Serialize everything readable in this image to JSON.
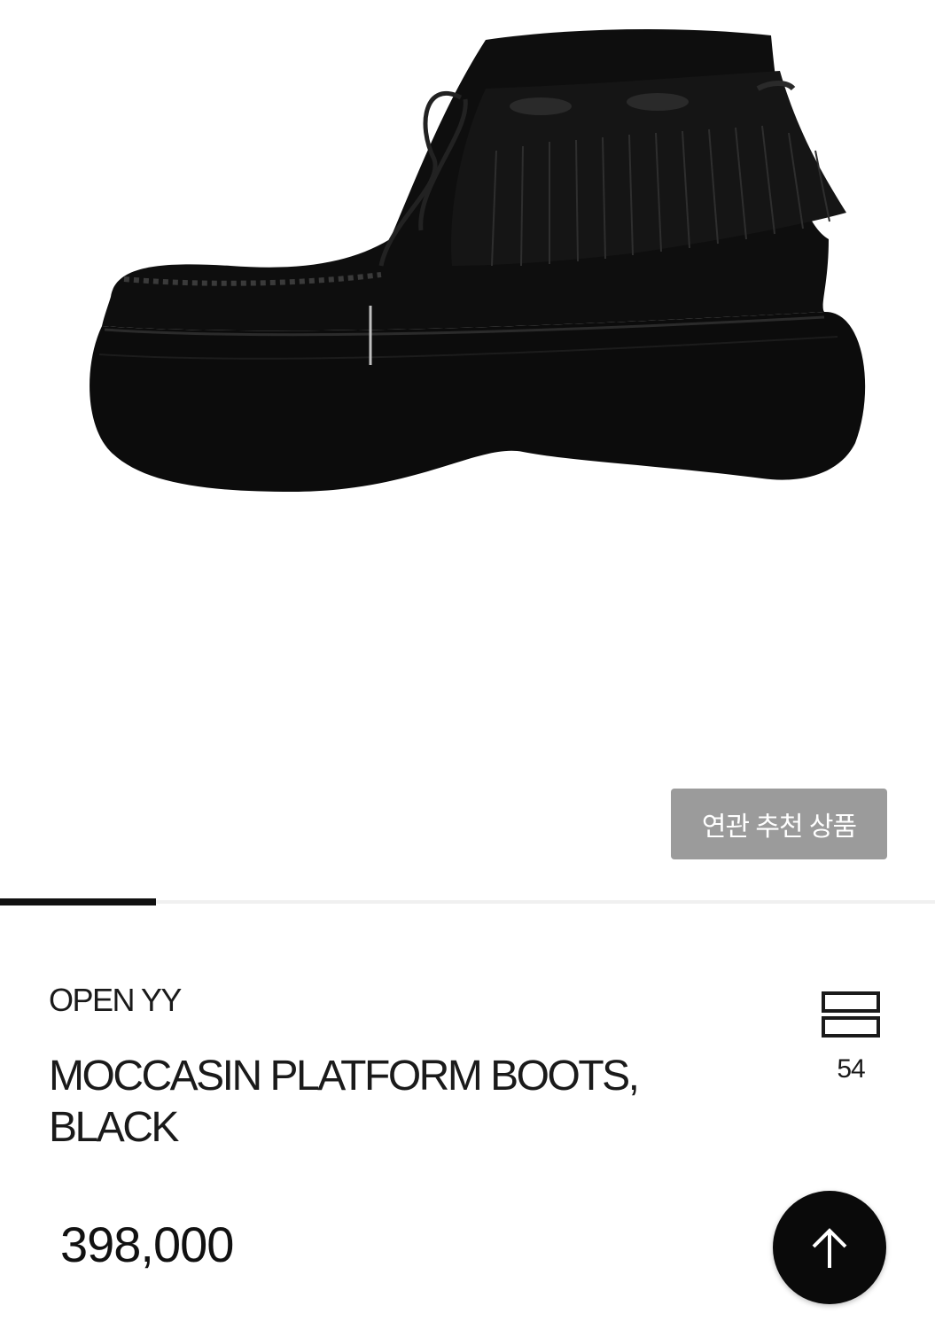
{
  "product": {
    "image_alt": "moccasin platform boot",
    "brand": "OPEN YY",
    "name": "MOCCASIN PLATFORM BOOTS, BLACK",
    "price": "398,000",
    "like_count": "54"
  },
  "actions": {
    "related_label": "연관 추천 상품"
  },
  "gallery": {
    "progress": 0.167
  },
  "icons": {
    "like": "stacked-bars-icon",
    "scroll_top": "arrow-up-icon"
  },
  "colors": {
    "accent": "#0a0a0a",
    "related_button": "#9b9b9b"
  }
}
